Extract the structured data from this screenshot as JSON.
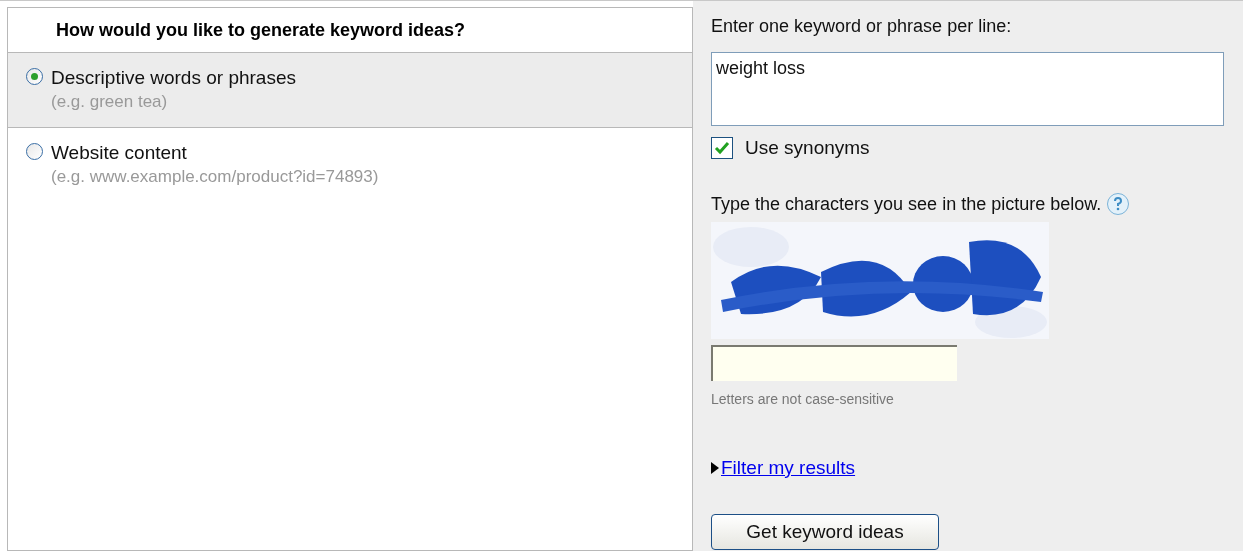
{
  "left_panel": {
    "heading": "How would you like to generate keyword ideas?",
    "options": [
      {
        "label": "Descriptive words or phrases",
        "example": "(e.g. green tea)",
        "selected": true
      },
      {
        "label": "Website content",
        "example": "(e.g. www.example.com/product?id=74893)",
        "selected": false
      }
    ]
  },
  "right_panel": {
    "keywords_label": "Enter one keyword or phrase per line:",
    "keywords_value": "weight loss",
    "synonyms": {
      "label": "Use synonyms",
      "checked": true
    },
    "captcha_prompt": "Type the characters you see in the picture below.",
    "captcha_hint": "Letters are not case-sensitive",
    "filter_link": "Filter my results",
    "submit_button": "Get keyword ideas"
  }
}
